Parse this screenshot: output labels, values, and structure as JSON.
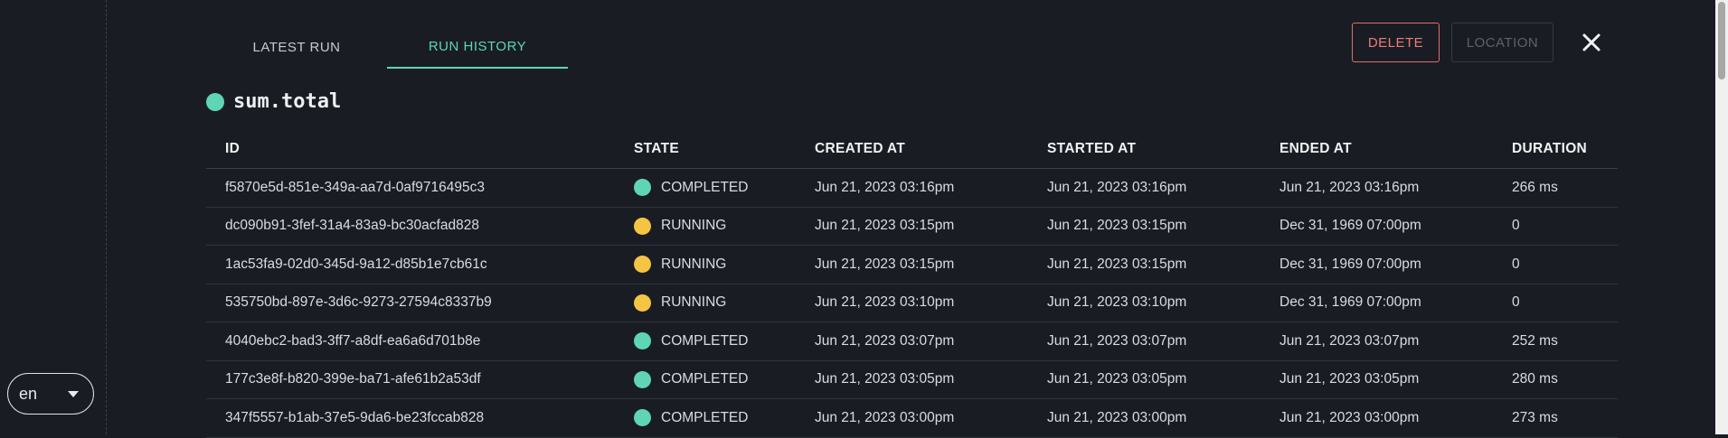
{
  "language": {
    "selected": "en"
  },
  "tabs": [
    {
      "label": "LATEST RUN",
      "active": false
    },
    {
      "label": "RUN HISTORY",
      "active": true
    }
  ],
  "actions": {
    "delete_label": "DELETE",
    "location_label": "LOCATION"
  },
  "task": {
    "name": "sum.total",
    "status_color": "#5fd5b6"
  },
  "table": {
    "columns": [
      "ID",
      "STATE",
      "CREATED AT",
      "STARTED AT",
      "ENDED AT",
      "DURATION"
    ],
    "rows": [
      {
        "id": "f5870e5d-851e-349a-aa7d-0af9716495c3",
        "state": "COMPLETED",
        "created_at": "Jun 21, 2023 03:16pm",
        "started_at": "Jun 21, 2023 03:16pm",
        "ended_at": "Jun 21, 2023 03:16pm",
        "duration": "266 ms"
      },
      {
        "id": "dc090b91-3fef-31a4-83a9-bc30acfad828",
        "state": "RUNNING",
        "created_at": "Jun 21, 2023 03:15pm",
        "started_at": "Jun 21, 2023 03:15pm",
        "ended_at": "Dec 31, 1969 07:00pm",
        "duration": "0"
      },
      {
        "id": "1ac53fa9-02d0-345d-9a12-d85b1e7cb61c",
        "state": "RUNNING",
        "created_at": "Jun 21, 2023 03:15pm",
        "started_at": "Jun 21, 2023 03:15pm",
        "ended_at": "Dec 31, 1969 07:00pm",
        "duration": "0"
      },
      {
        "id": "535750bd-897e-3d6c-9273-27594c8337b9",
        "state": "RUNNING",
        "created_at": "Jun 21, 2023 03:10pm",
        "started_at": "Jun 21, 2023 03:10pm",
        "ended_at": "Dec 31, 1969 07:00pm",
        "duration": "0"
      },
      {
        "id": "4040ebc2-bad3-3ff7-a8df-ea6a6d701b8e",
        "state": "COMPLETED",
        "created_at": "Jun 21, 2023 03:07pm",
        "started_at": "Jun 21, 2023 03:07pm",
        "ended_at": "Jun 21, 2023 03:07pm",
        "duration": "252 ms"
      },
      {
        "id": "177c3e8f-b820-399e-ba71-afe61b2a53df",
        "state": "COMPLETED",
        "created_at": "Jun 21, 2023 03:05pm",
        "started_at": "Jun 21, 2023 03:05pm",
        "ended_at": "Jun 21, 2023 03:05pm",
        "duration": "280 ms"
      },
      {
        "id": "347f5557-b1ab-37e5-9da6-be23fccab828",
        "state": "COMPLETED",
        "created_at": "Jun 21, 2023 03:00pm",
        "started_at": "Jun 21, 2023 03:00pm",
        "ended_at": "Jun 21, 2023 03:00pm",
        "duration": "273 ms"
      }
    ]
  },
  "state_colors": {
    "COMPLETED": "#5fd5b6",
    "RUNNING": "#f6c443"
  },
  "icons": {
    "close": "close-icon",
    "caret": "chevron-down-icon",
    "status": "status-dot-icon"
  }
}
